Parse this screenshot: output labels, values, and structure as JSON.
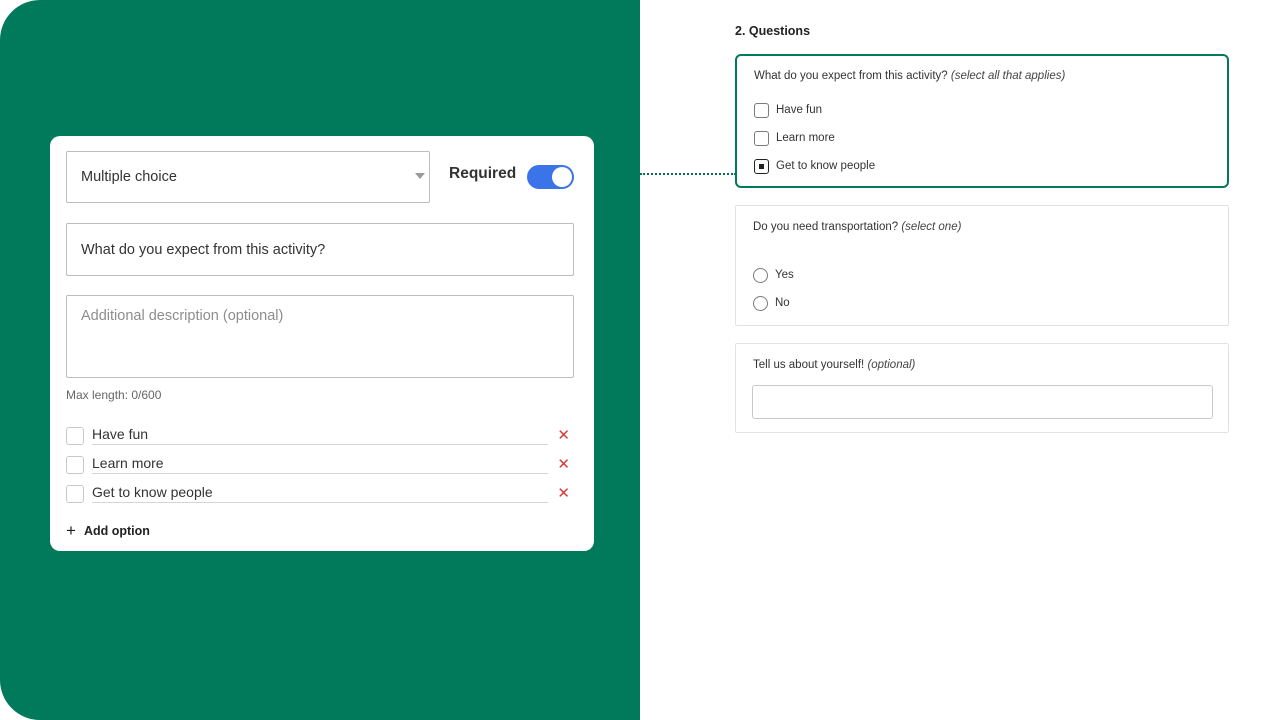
{
  "editor": {
    "question_type": "Multiple choice",
    "required_label": "Required",
    "required_on": true,
    "question_value": "What do you expect from this activity?",
    "description_placeholder": "Additional description (optional)",
    "max_length_label": "Max length: 0/600",
    "options": [
      {
        "label": "Have fun"
      },
      {
        "label": "Learn more"
      },
      {
        "label": "Get to know people"
      }
    ],
    "delete_glyph": "✕",
    "add_option_glyph": "+",
    "add_option_label": "Add option"
  },
  "preview": {
    "section_title": "2. Questions",
    "questions": [
      {
        "title": "What do you expect from this activity?",
        "hint": "(select all that applies)",
        "options": [
          {
            "label": "Have fun",
            "checked": false
          },
          {
            "label": "Learn more",
            "checked": false
          },
          {
            "label": "Get to know people",
            "checked": true
          }
        ]
      },
      {
        "title": "Do you need transportation?",
        "hint": "(select one)",
        "options": [
          {
            "label": "Yes",
            "checked": false
          },
          {
            "label": "No",
            "checked": false
          }
        ]
      },
      {
        "title": "Tell us about yourself!",
        "hint": "(optional)",
        "answer_value": ""
      }
    ]
  },
  "colors": {
    "brand_green": "#017a5b",
    "toggle_blue": "#3b73e8",
    "delete_red": "#d93a3a"
  }
}
